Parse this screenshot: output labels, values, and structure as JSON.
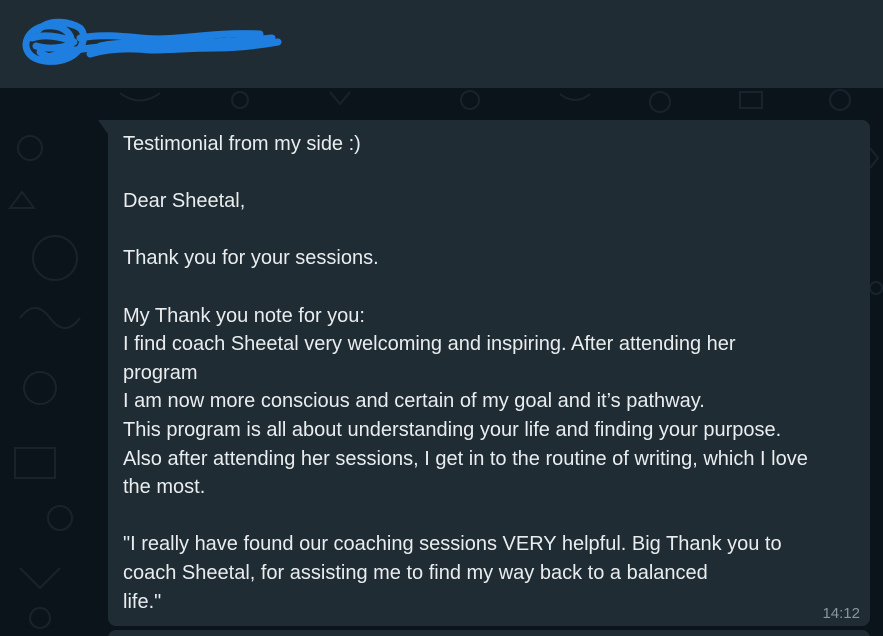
{
  "chat": {
    "contact_name": "",
    "message": {
      "text": "Testimonial from my side :)\n\nDear Sheetal,\n\nThank you for your sessions.\n\nMy Thank you note for you:\nI find coach Sheetal very welcoming and inspiring. After attending her\nprogram\nI am now more conscious and certain of my goal and it’s pathway.\nThis program is all about understanding your life and finding your purpose.\nAlso after attending her sessions, I get in to the routine of writing, which I love\nthe most.\n\n\"I really have found our coaching sessions VERY helpful. Big Thank you to\ncoach Sheetal, for assisting me to find my way back to a balanced\nlife.\"",
      "time": "14:12"
    }
  },
  "colors": {
    "header_bg": "#202c33",
    "chat_bg": "#0b141a",
    "bubble_bg": "#202c33",
    "text": "#e9edef",
    "meta": "#8696a0",
    "redaction": "#1e7fe0"
  }
}
